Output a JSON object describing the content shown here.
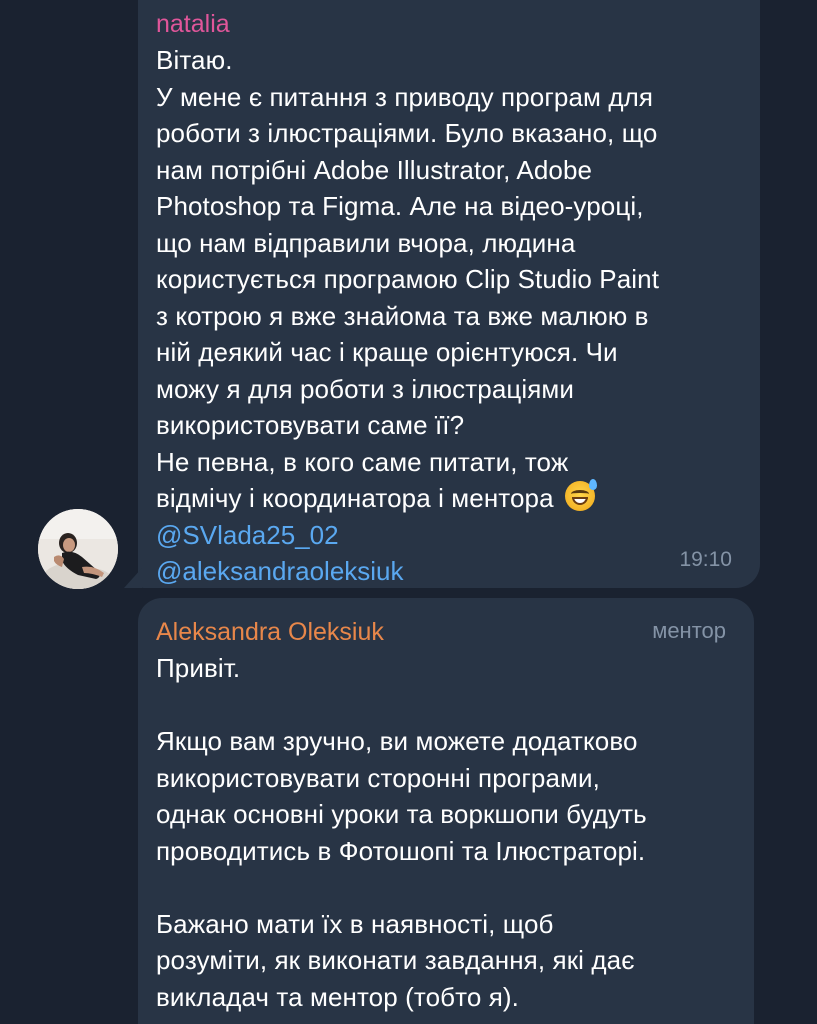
{
  "messages": [
    {
      "sender": "natalia",
      "sender_color": "#e0569a",
      "text": "Вітаю.\nУ мене є питання з приводу програм для\nроботи з ілюстраціями. Було вказано, що\nнам потрібні Adobe Illustrator, Adobe\nPhotoshop та Figma. Але на відео-уроці,\nщо нам відправили вчора, людина\nкористується програмою Clip Studio Paint\nз котрою я вже знайома та вже малюю в\nній деякий час і краще орієнтуюся. Чи\nможу я для роботи з ілюстраціями\nвикористовувати саме її?\nНе певна, в кого саме питати, тож\nвідмічу і координатора і ментора",
      "emoji": "grinning-face-with-sweat-emoji",
      "mentions": [
        "@SVlada25_02",
        "@aleksandraoleksiuk"
      ],
      "time": "19:10"
    },
    {
      "sender": "Aleksandra Oleksiuk",
      "sender_color": "#e8874a",
      "role": "ментор",
      "text": "Привіт.\n\nЯкщо вам зручно, ви можете додатково\nвикористовувати сторонні програми,\nоднак основні уроки та воркшопи будуть\nпроводитись в Фотошопі та Ілюстраторі.\n\nБажано мати їх в наявності, щоб\nрозуміти, як виконати завдання, які дає\nвикладач та ментор (тобто я)."
    }
  ],
  "colors": {
    "background": "#1a2230",
    "bubble": "#283445",
    "mention": "#5aa8f0",
    "meta": "#8493a6"
  }
}
